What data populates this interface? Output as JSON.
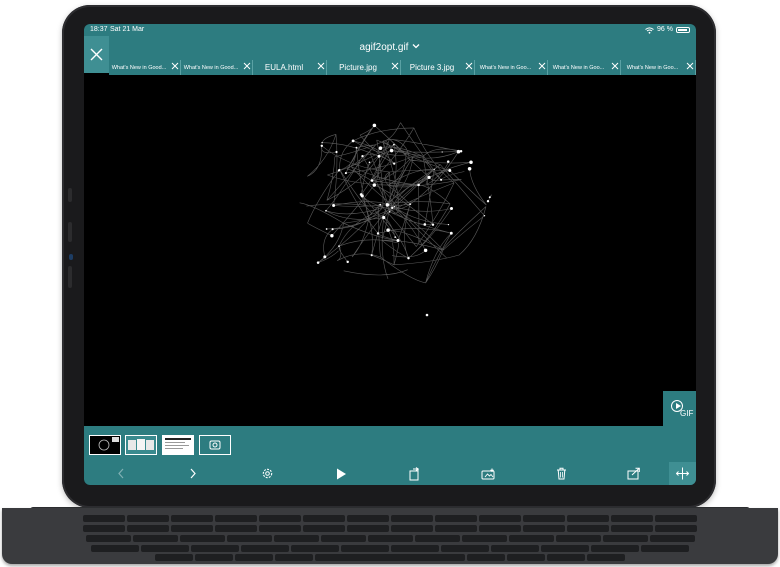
{
  "status_bar": {
    "time": "18:37",
    "date": "Sat 21 Mar",
    "battery": "96 %"
  },
  "title_bar": {
    "title": "agif2opt.gif",
    "close_icon": "close-icon",
    "dropdown_icon": "chevron-down-icon"
  },
  "tabs": [
    {
      "label": "What's New in Good...",
      "size": "small"
    },
    {
      "label": "What's New in Good...",
      "size": "small"
    },
    {
      "label": "EULA.html",
      "size": "big"
    },
    {
      "label": "Picture.jpg",
      "size": "big"
    },
    {
      "label": "Picture 3.jpg",
      "size": "big"
    },
    {
      "label": "What's New in Goo...",
      "size": "small"
    },
    {
      "label": "What's New in Goo...",
      "size": "small"
    },
    {
      "label": "What's New in Goo...",
      "size": "small"
    }
  ],
  "gif_button": {
    "label": "GIF",
    "icon": "play-circle-icon"
  },
  "thumbnails": [
    "gif-thumbnail",
    "slides-thumbnail",
    "document-thumbnail",
    "camera-thumbnail"
  ],
  "toolbar": {
    "items": [
      "back-icon",
      "forward-icon",
      "settings-icon",
      "play-icon",
      "rotate-icon",
      "add-photo-icon",
      "trash-icon",
      "share-icon",
      "pan-icon"
    ]
  },
  "colors": {
    "teal": "#2d7c80",
    "teal_active": "#3f8f93",
    "screen_bg": "#000000"
  }
}
